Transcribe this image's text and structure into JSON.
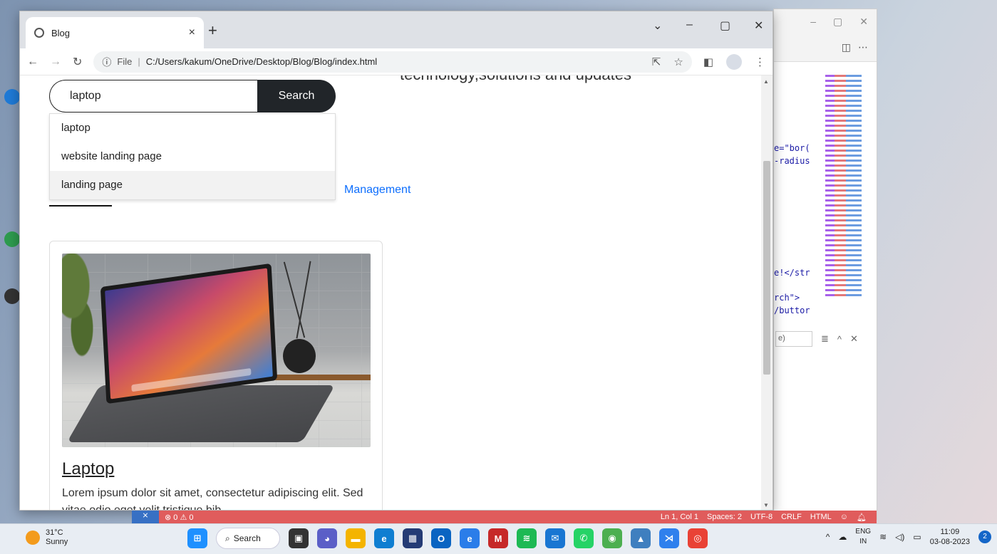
{
  "browser": {
    "tab_title": "Blog",
    "close_tab": "×",
    "new_tab": "+",
    "url_file_label": "File",
    "url": "C:/Users/kakum/OneDrive/Desktop/Blog/Blog/index.html",
    "tab_list": "⌄",
    "minimize": "–",
    "maximize": "▢",
    "close": "✕"
  },
  "page": {
    "partial_heading": "technology,solutions and updates",
    "search_value": "laptop",
    "search_button": "Search",
    "suggestions": [
      "laptop",
      "website landing page",
      "landing page"
    ],
    "nav_link": "Management",
    "card": {
      "title": "Laptop",
      "text": "Lorem ipsum dolor sit amet, consectetur adipiscing elit. Sed vitae odio eget velit tristique bib"
    }
  },
  "vscode": {
    "code_lines": [
      "e=\"bor(",
      "-radius",
      "e!</str",
      "rch\">",
      "/buttor"
    ],
    "find_placeholder": "e)"
  },
  "statusbar": {
    "problems": "⊗ 0 ⚠ 0",
    "position": "Ln 1, Col 1",
    "spaces": "Spaces: 2",
    "encoding": "UTF-8",
    "eol": "CRLF",
    "language": "HTML"
  },
  "taskbar": {
    "temperature": "31°C",
    "weather": "Sunny",
    "search": "Search",
    "lang_top": "ENG",
    "lang_bottom": "IN",
    "time": "11:09",
    "date": "03-08-2023",
    "notifications": "2"
  }
}
